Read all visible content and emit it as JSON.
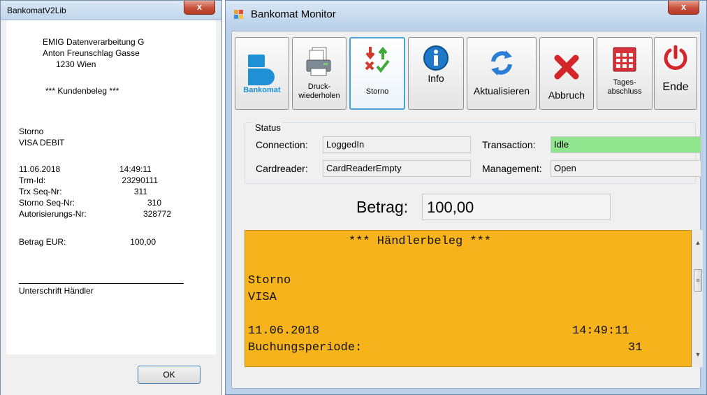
{
  "dialog": {
    "title": "BankomatV2Lib",
    "close_label": "x",
    "company_line1": "EMIG Datenverarbeitung G",
    "company_line2": "Anton Freunschlag Gasse",
    "company_line3": "1230 Wien",
    "heading": "*** Kundenbeleg ***",
    "type": "Storno",
    "card": "VISA DEBIT",
    "date": "11.06.2018",
    "time": "14:49:11",
    "rows": [
      {
        "label": "Trm-Id:",
        "value": "23290111"
      },
      {
        "label": "Trx Seq-Nr:",
        "value": "311"
      },
      {
        "label": "Storno Seq-Nr:",
        "value": "310"
      },
      {
        "label": "Autorisierungs-Nr:",
        "value": "328772"
      }
    ],
    "betrag_label": "Betrag EUR:",
    "betrag_value": "100,00",
    "signature_label": "Unterschrift Händler",
    "ok_label": "OK"
  },
  "window": {
    "title": "Bankomat Monitor",
    "close_label": "x",
    "toolbar": [
      {
        "label": "Bankomat",
        "icon": "bankomat-logo-icon"
      },
      {
        "label": "Druck-\nwiederholen",
        "icon": "printer-icon"
      },
      {
        "label": "Storno",
        "icon": "storno-arrows-icon"
      },
      {
        "label": "Info",
        "icon": "info-icon"
      },
      {
        "label": "Aktualisieren",
        "icon": "refresh-icon"
      },
      {
        "label": "Abbruch",
        "icon": "cancel-x-icon"
      },
      {
        "label": "Tages-\nabschluss",
        "icon": "calendar-icon"
      },
      {
        "label": "Ende",
        "icon": "power-icon"
      }
    ],
    "status": {
      "legend": "Status",
      "connection_label": "Connection:",
      "connection_value": "LoggedIn",
      "transaction_label": "Transaction:",
      "transaction_value": "Idle",
      "cardreader_label": "Cardreader:",
      "cardreader_value": "CardReaderEmpty",
      "management_label": "Management:",
      "management_value": "Open"
    },
    "betrag_label": "Betrag:",
    "betrag_value": "100,00",
    "receipt": {
      "heading": "*** Händlerbeleg ***",
      "line_storno": "Storno",
      "line_visa": "VISA",
      "date": "11.06.2018",
      "time": "14:49:11",
      "period_label": "Buchungsperiode:",
      "period_value": "31"
    },
    "colors": {
      "receipt_bg": "#f7b31b",
      "idle_bg": "#8fe68f",
      "bankomat_blue": "#1f8fd6",
      "close_red": "#c7503a"
    }
  }
}
